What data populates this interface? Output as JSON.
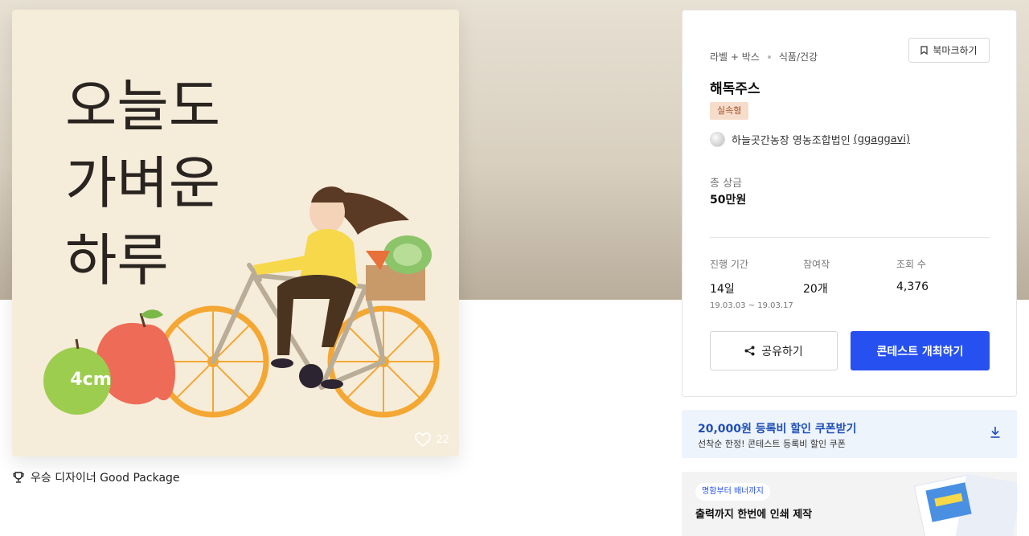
{
  "artwork": {
    "lines": [
      "오늘도",
      "가벼운",
      "하루"
    ],
    "apple_label": "4cm",
    "like_count": "22"
  },
  "award": {
    "text": "우승 디자이너 Good Package",
    "icon": "trophy-icon"
  },
  "panel": {
    "categories": [
      "라벨 + 박스",
      "식품/건강"
    ],
    "bookmark_label": "북마크하기",
    "title": "해독주스",
    "badge": "실속형",
    "host_name": "하늘곳간농장 영농조합법인",
    "host_handle": "(ggaggavi)",
    "prize_label": "총 상금",
    "prize_value": "50만원",
    "stats": [
      {
        "label": "진행 기간",
        "value": "14일",
        "sub": "19.03.03 ~ 19.03.17"
      },
      {
        "label": "참여작",
        "value": "20개"
      },
      {
        "label": "조회 수",
        "value": "4,376"
      }
    ],
    "share_label": "공유하기",
    "host_button_label": "콘테스트 개최하기"
  },
  "coupon": {
    "title": "20,000원 등록비 할인 쿠폰받기",
    "subtitle": "선착순 한정! 콘테스트 등록비 할인 쿠폰"
  },
  "ad": {
    "pill": "명함부터 배너까지",
    "title": "출력까지 한번에 인쇄 제작"
  },
  "colors": {
    "accent": "#2651f0",
    "badge_bg": "#f6dccb",
    "coupon_text": "#1f4fb8"
  }
}
